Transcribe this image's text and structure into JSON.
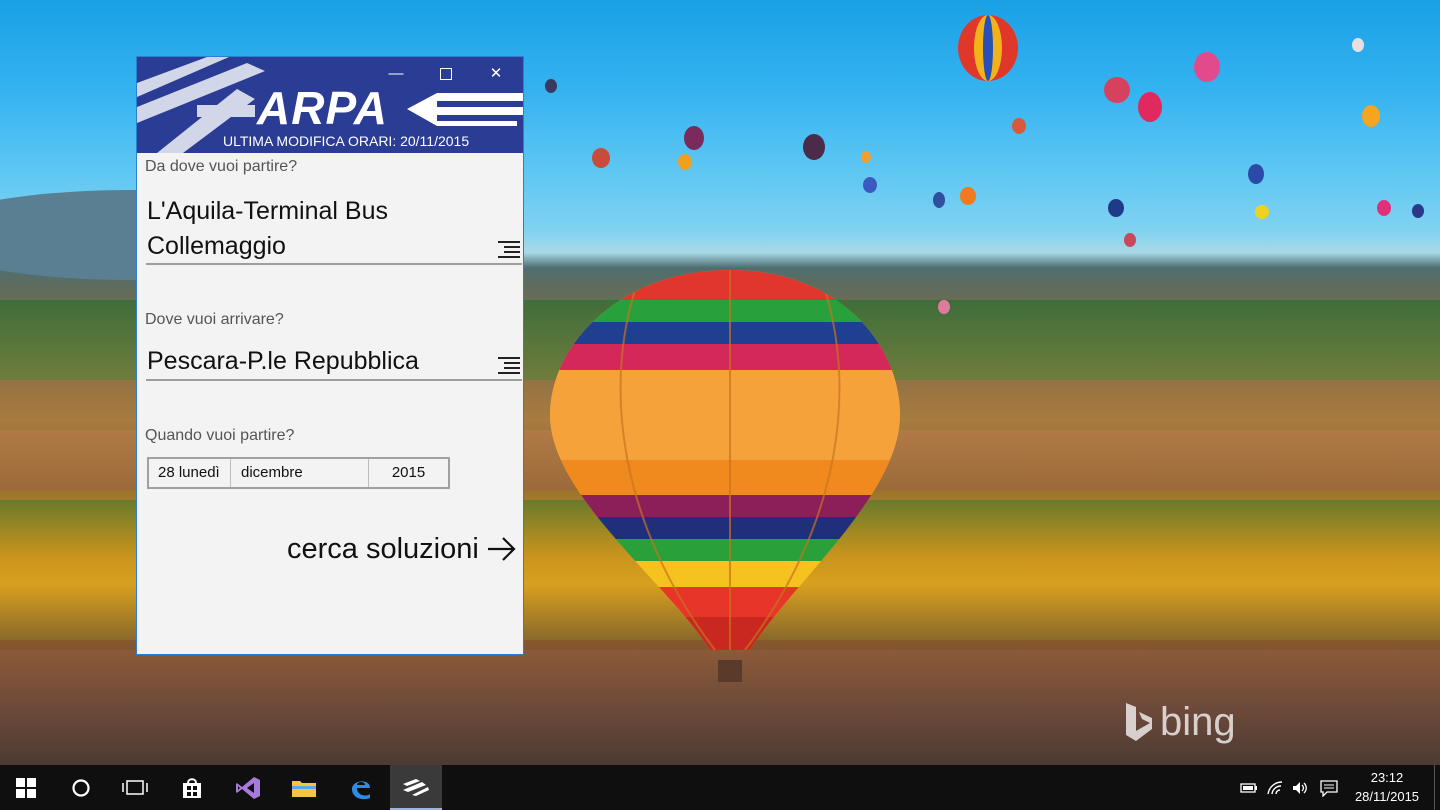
{
  "desktop": {
    "watermark": "bing"
  },
  "window": {
    "caption_buttons": [
      "minimize",
      "maximize",
      "close"
    ],
    "logo": "ARPA",
    "update_banner": "ULTIMA MODIFICA ORARI: 20/11/2015",
    "accent_color": "#2a3c93"
  },
  "form": {
    "from": {
      "label": "Da dove vuoi partire?",
      "value_line1": "L'Aquila-Terminal Bus",
      "value_line2": "Collemaggio"
    },
    "to": {
      "label": "Dove vuoi arrivare?",
      "value": "Pescara-P.le Repubblica"
    },
    "date": {
      "label": "Quando vuoi partire?",
      "day": "28 lunedì",
      "month": "dicembre",
      "year": "2015"
    },
    "search_label": "cerca soluzioni"
  },
  "taskbar": {
    "items": [
      "start-icon",
      "cortana-icon",
      "task-view-icon",
      "store-icon",
      "visual-studio-icon",
      "file-explorer-icon",
      "edge-icon",
      "arpa-app-icon"
    ],
    "active_item": "arpa-app-icon",
    "time": "23:12",
    "date": "28/11/2015"
  }
}
